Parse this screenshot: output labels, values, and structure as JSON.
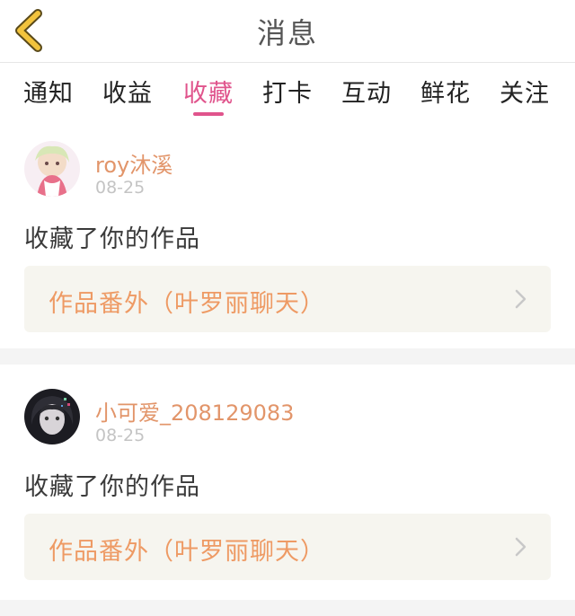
{
  "header": {
    "title": "消息",
    "back_icon": "chevron-left-icon",
    "accent_color": "#f2c33d"
  },
  "tabs": [
    {
      "label": "通知",
      "active": false
    },
    {
      "label": "收益",
      "active": false
    },
    {
      "label": "收藏",
      "active": true
    },
    {
      "label": "打卡",
      "active": false
    },
    {
      "label": "互动",
      "active": false
    },
    {
      "label": "鲜花",
      "active": false
    },
    {
      "label": "关注",
      "active": false
    }
  ],
  "messages": [
    {
      "username": "roy沐溪",
      "date": "08-25",
      "action": "收藏了你的作品",
      "work_title": "作品番外（叶罗丽聊天）"
    },
    {
      "username": "小可爱_208129083",
      "date": "08-25",
      "action": "收藏了你的作品",
      "work_title": "作品番外（叶罗丽聊天）"
    }
  ],
  "colors": {
    "tab_active": "#e0548c",
    "username": "#e2956a",
    "work_title": "#ee9a64",
    "work_box_bg": "#f6f5ef"
  }
}
